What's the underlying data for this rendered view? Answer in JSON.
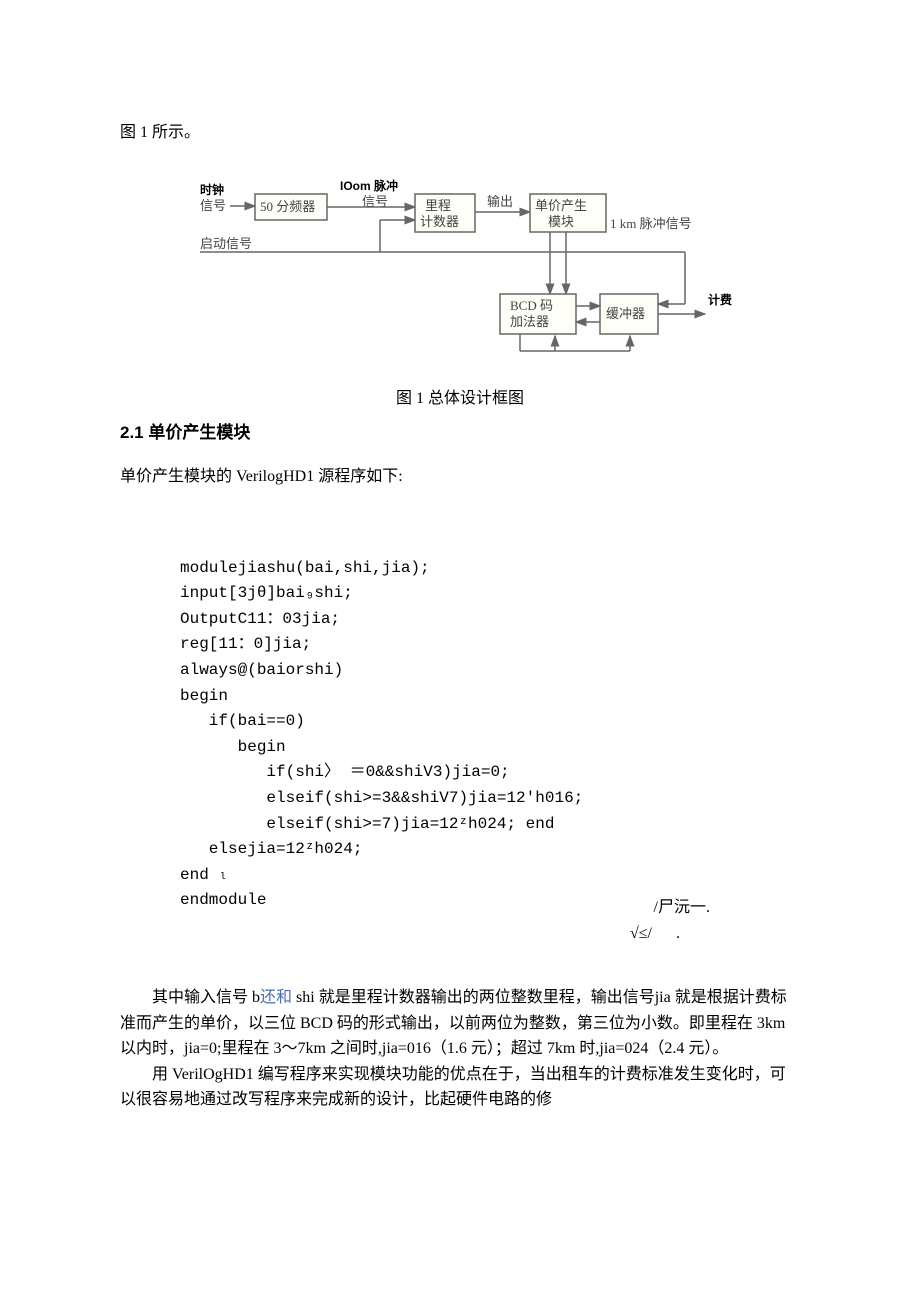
{
  "top_line": "图 1 所示。",
  "diagram": {
    "label_shizhong": "时钟",
    "label_xinhao_left": "信号",
    "label_100m_mochong": "IOom 脉冲",
    "label_xinhao_top": "信号",
    "box_divider": "50 分频器",
    "label_qidong": "启动信号",
    "box_licheng": "里程\n计数器",
    "label_shuchu": "输出",
    "box_danjia": "单价产生\n模块",
    "label_1km": "1 km 脉冲信号",
    "box_bcd": "BCD 码\n加法器",
    "box_buffer": "缓冲器",
    "label_jifei": "计费"
  },
  "caption": "图 1 总体设计框图",
  "section_2_1": "2.1 单价产生模块",
  "intro_2_1": "单价产生模块的 VerilogHD1 源程序如下:",
  "code": {
    "l1": "modulejiashu(bai,shi,jia);",
    "l2": "input[3jθ]bai₉shi;",
    "l3": "OutputC11：03jia;",
    "l4": "reg[11：0]jia;",
    "l5": "always@(baiorshi)",
    "l6": "begin",
    "l7": "   if(bai==0)",
    "l8": "      begin",
    "l9": "         if(shi〉 ＝0&&shiV3)jia=0;",
    "l10": "         elseif(shi>=3&&shiV7)jia=12'h016;",
    "l11": "         elseif(shi>=7)jia=12ᶻh024; end",
    "l12": "   elsejia=12ᶻh024;",
    "l13": "end ₗ",
    "l14": "endmodule"
  },
  "stray": {
    "s1": "/尸沅一.",
    "s2": "√≤/      ."
  },
  "para1_part1": "其中输入信号 b",
  "para1_link": "还和",
  "para1_part2": " shi 就是里程计数器输出的两位整数里程，输出信号jia 就是根据计费标准而产生的单价，以三位 BCD 码的形式输出，以前两位为整数，第三位为小数。即里程在 3km 以内时，jia=0;里程在 3～7km 之间时,jia=016（1.6 元）；超过 7km 时,jia=024（2.4 元）。",
  "para2": "用 VerilOgHD1 编写程序来实现模块功能的优点在于，当出租车的计费标准发生变化时，可以很容易地通过改写程序来完成新的设计，比起硬件电路的修",
  "chart_data": {
    "type": "diagram",
    "nodes": [
      {
        "id": "divider",
        "label": "50 分频器"
      },
      {
        "id": "licheng",
        "label": "里程计数器"
      },
      {
        "id": "danjia",
        "label": "单价产生模块"
      },
      {
        "id": "bcd",
        "label": "BCD 码加法器"
      },
      {
        "id": "buffer",
        "label": "缓冲器"
      }
    ],
    "edges": [
      {
        "from": "时钟信号",
        "to": "divider"
      },
      {
        "from": "divider",
        "to": "licheng",
        "label": "IOom 脉冲信号"
      },
      {
        "from": "启动信号",
        "to": "licheng"
      },
      {
        "from": "启动信号",
        "to": "danjia"
      },
      {
        "from": "启动信号",
        "to": "bcd"
      },
      {
        "from": "licheng",
        "to": "danjia",
        "label": "输出"
      },
      {
        "from": "danjia",
        "to": "bcd",
        "label": "1 km 脉冲信号"
      },
      {
        "from": "bcd",
        "to": "buffer"
      },
      {
        "from": "buffer",
        "to": "bcd"
      },
      {
        "from": "buffer",
        "to": "计费"
      }
    ]
  }
}
